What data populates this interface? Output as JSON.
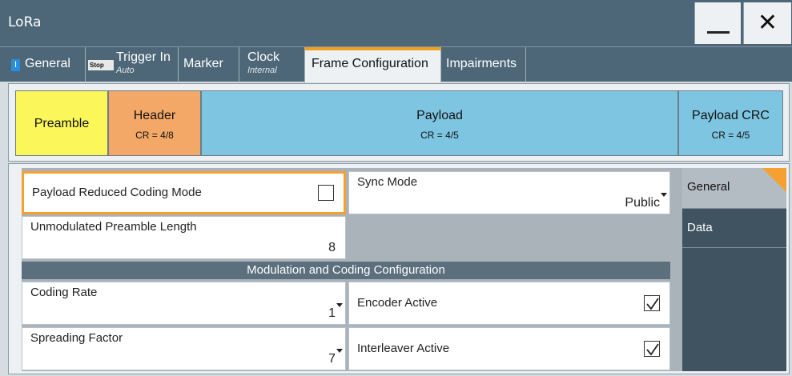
{
  "window": {
    "title": "LoRa"
  },
  "tabs": {
    "general": {
      "label": "General",
      "state_icon": "I"
    },
    "trigger": {
      "label": "Trigger In",
      "sub": "Auto",
      "state_icon": "Stop"
    },
    "marker": {
      "label": "Marker"
    },
    "clock": {
      "label": "Clock",
      "sub": "Internal"
    },
    "frame": {
      "label": "Frame Configuration"
    },
    "impairments": {
      "label": "Impairments"
    }
  },
  "frame": {
    "preamble": {
      "name": "Preamble"
    },
    "header": {
      "name": "Header",
      "cr": "CR = 4/8"
    },
    "payload": {
      "name": "Payload",
      "cr": "CR = 4/5"
    },
    "payload_crc": {
      "name": "Payload CRC",
      "cr": "CR = 4/5"
    }
  },
  "fields": {
    "payload_reduced": {
      "label": "Payload Reduced Coding Mode",
      "checked": false
    },
    "sync_mode": {
      "label": "Sync Mode",
      "value": "Public"
    },
    "preamble_len": {
      "label": "Unmodulated Preamble Length",
      "value": "8"
    },
    "section_title": "Modulation and Coding Configuration",
    "coding_rate": {
      "label": "Coding Rate",
      "value": "1"
    },
    "encoder_active": {
      "label": "Encoder Active",
      "checked": true
    },
    "spreading_factor": {
      "label": "Spreading Factor",
      "value": "7"
    },
    "interleaver_active": {
      "label": "Interleaver Active",
      "checked": true
    }
  },
  "side_tabs": {
    "general": "General",
    "data": "Data"
  },
  "colors": {
    "accent": "#f5a030",
    "header_bg": "#4d6778",
    "preamble": "#fbf65a",
    "header_block": "#f4a867",
    "payload_block": "#7ec5e1"
  }
}
